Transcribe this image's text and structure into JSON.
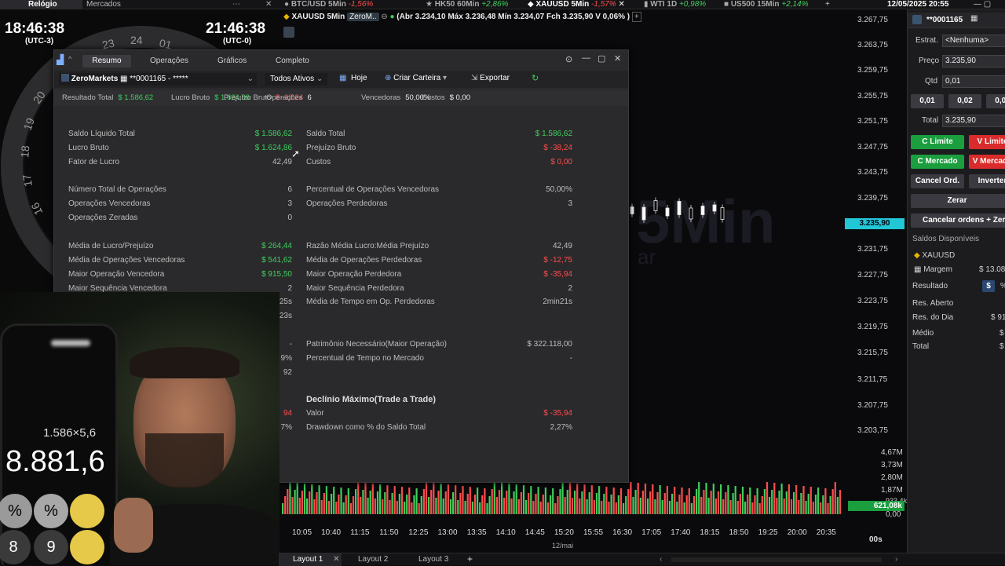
{
  "topbar": {
    "tab_clock": "Relógio",
    "tab_markets": "Mercados",
    "tickers": [
      {
        "symbol": "BTC/USD 5Min",
        "change": "-1,56%"
      },
      {
        "symbol": "HK50 60Min",
        "change": "+2,86%"
      },
      {
        "symbol": "XAUUSD 5Min",
        "change": "-1,57%"
      },
      {
        "symbol": "WTI 1D",
        "change": "+0,98%"
      },
      {
        "symbol": "US500 15Min",
        "change": "+2,14%"
      }
    ],
    "datetime": "12/05/2025 20:55"
  },
  "clocks": {
    "left_time": "18:46:38",
    "left_tz": "(UTC-3)",
    "right_time": "21:46:38",
    "right_tz": "(UTC-0)",
    "dial": [
      "23",
      "24",
      "01",
      "20",
      "19",
      "18",
      "17",
      "16"
    ]
  },
  "chart": {
    "symbol": "XAUUSD 5Min",
    "broker": "ZeroM..",
    "ohlc": "(Abr 3.234,10 Máx 3.236,48 Mín 3.234,07 Fch 3.235,90 V 0,06% )",
    "watermark": "5Min",
    "watermark2": "ar",
    "current_price": "3.235,90",
    "price_levels": [
      "3.267,75",
      "3.263,75",
      "3.259,75",
      "3.255,75",
      "3.251,75",
      "3.247,75",
      "3.243,75",
      "3.239,75",
      "3.231,75",
      "3.227,75",
      "3.223,75",
      "3.219,75",
      "3.215,75",
      "3.211,75",
      "3.207,75",
      "3.203,75"
    ],
    "volume_levels": [
      "4,67M",
      "3,73M",
      "2,80M",
      "1,87M",
      "933,4k",
      "0,00"
    ],
    "volume_current": "621,08k",
    "time_labels": [
      "10:05",
      "10:40",
      "11:15",
      "11:50",
      "12:25",
      "13:00",
      "13:35",
      "14:10",
      "14:45",
      "15:20",
      "15:55",
      "16:30",
      "17:05",
      "17:40",
      "18:15",
      "18:50",
      "19:25",
      "20:00",
      "20:35"
    ],
    "date_label": "12/mai",
    "countdown": "00s"
  },
  "right_panel": {
    "account": "**0001165",
    "strategy_label": "Estrat.",
    "strategy_value": "<Nenhuma>",
    "price_label": "Preço",
    "price_value": "3.235,90",
    "qty_label": "Qtd",
    "qty_value": "0,01",
    "lot_buttons": [
      "0,01",
      "0,02",
      "0,05"
    ],
    "total_label": "Total",
    "total_value": "3.235,90",
    "buy_limit": "C Limite",
    "sell_limit": "V Limite",
    "buy_market": "C Mercado",
    "sell_market": "V Mercado",
    "cancel_orders": "Cancel Ord.",
    "invert": "Inverter",
    "zero": "Zerar",
    "cancel_and_zero": "Cancelar ordens + Zerar",
    "balances_title": "Saldos Disponíveis",
    "asset": "XAUUSD",
    "margin_label": "Margem",
    "margin_value": "$ 13.08",
    "result_label": "Resultado",
    "result_currency": "$",
    "result_pct": "%",
    "open_res_label": "Res. Aberto",
    "day_res_label": "Res. do Dia",
    "day_res_value": "$ 91",
    "avg_label": "Médio",
    "avg_value": "$",
    "total2_label": "Total",
    "total2_value": "$"
  },
  "dialog": {
    "tabs": [
      "Resumo",
      "Operações",
      "Gráficos",
      "Completo"
    ],
    "account_broker": "ZeroMarkets",
    "account_id": "**0001165 - *****",
    "asset_filter": "Todos Ativos",
    "today": "Hoje",
    "create_portfolio": "Criar Carteira",
    "export": "Exportar",
    "summary": [
      {
        "label": "Resultado Total",
        "value": "$ 1.586,62",
        "tone": "pos"
      },
      {
        "label": "Lucro Bruto",
        "value": "$ 1.624,86",
        "tone": "pos"
      },
      {
        "label": "Prejuízo Bruto",
        "value": "$ -38,24",
        "tone": "neg"
      },
      {
        "label": "Operações",
        "value": "6",
        "tone": "plain"
      },
      {
        "label": "Vencedoras",
        "value": "50,00%",
        "tone": "plain"
      },
      {
        "label": "Custos",
        "value": "$ 0,00",
        "tone": "plain"
      }
    ],
    "left": [
      {
        "label": "Saldo Líquido Total",
        "value": "$ 1.586,62",
        "tone": "pos"
      },
      {
        "label": "Lucro Bruto",
        "value": "$ 1.624,86",
        "tone": "pos"
      },
      {
        "label": "Fator de Lucro",
        "value": "42,49",
        "tone": "plain"
      },
      {
        "label": "Número Total de Operações",
        "value": "6",
        "tone": "plain"
      },
      {
        "label": "Operações Vencedoras",
        "value": "3",
        "tone": "plain"
      },
      {
        "label": "Operações Zeradas",
        "value": "0",
        "tone": "plain"
      },
      {
        "label": "Média de Lucro/Prejuízo",
        "value": "$ 264,44",
        "tone": "pos"
      },
      {
        "label": "Média de Operações Vencedoras",
        "value": "$ 541,62",
        "tone": "pos"
      },
      {
        "label": "Maior Operação Vencedora",
        "value": "$ 915,50",
        "tone": "pos"
      },
      {
        "label": "Maior Sequência Vencedora",
        "value": "2",
        "tone": "plain"
      }
    ],
    "left_partial": [
      "25s",
      "23s",
      "-",
      "9%",
      "92",
      "94",
      "7%"
    ],
    "right": [
      {
        "label": "Saldo Total",
        "value": "$ 1.586,62",
        "tone": "pos"
      },
      {
        "label": "Prejuízo Bruto",
        "value": "$ -38,24",
        "tone": "neg"
      },
      {
        "label": "Custos",
        "value": "$ 0,00",
        "tone": "neg"
      },
      {
        "label": "Percentual de Operações Vencedoras",
        "value": "50,00%",
        "tone": "plain"
      },
      {
        "label": "Operações Perdedoras",
        "value": "3",
        "tone": "plain"
      },
      {
        "label": "Razão Média Lucro:Média Prejuízo",
        "value": "42,49",
        "tone": "plain"
      },
      {
        "label": "Média de Operações Perdedoras",
        "value": "$ -12,75",
        "tone": "neg"
      },
      {
        "label": "Maior Operação Perdedora",
        "value": "$ -35,94",
        "tone": "neg"
      },
      {
        "label": "Maior Sequência Perdedora",
        "value": "2",
        "tone": "plain"
      },
      {
        "label": "Média de Tempo em Op. Perdedoras",
        "value": "2min21s",
        "tone": "plain"
      },
      {
        "label": "Patrimônio Necessário(Maior Operação)",
        "value": "$ 322.118,00",
        "tone": "plain"
      },
      {
        "label": "Percentual de Tempo no Mercado",
        "value": "-",
        "tone": "plain"
      }
    ],
    "drawdown_title": "Declínio Máximo(Trade a Trade)",
    "drawdown": [
      {
        "label": "Valor",
        "value": "$ -35,94",
        "tone": "neg"
      },
      {
        "label": "Drawdown como % do Saldo Total",
        "value": "2,27%",
        "tone": "plain"
      }
    ]
  },
  "webcam": {
    "calc_expression": "1.586×5,6",
    "calc_result": "8.881,6",
    "keys": [
      "%",
      "%",
      "8",
      "9"
    ]
  },
  "bottombar": {
    "layouts": [
      "Layout 1",
      "Layout 2",
      "Layout 3"
    ]
  },
  "colors": {
    "up": "#3fcf5c",
    "down": "#ff4d4d",
    "price_tag": "#22c7d6",
    "buy": "#1a9e3e",
    "sell": "#d92b2b"
  }
}
